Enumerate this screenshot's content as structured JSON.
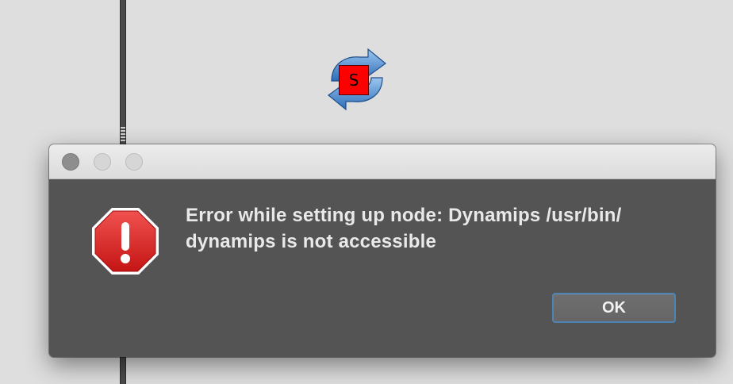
{
  "background": {
    "node": {
      "badge_letter": "S",
      "icon": "refresh-arrows-icon",
      "badge_color": "#ff0000"
    }
  },
  "dialog": {
    "title_buttons": [
      "close-icon",
      "minimize-icon",
      "zoom-icon"
    ],
    "icon": "stop-sign-warning-icon",
    "message": "Error while setting up node: Dynamips /usr/bin/ dynamips is not accessible",
    "ok_label": "OK",
    "colors": {
      "dialog_background": "#545454",
      "button_focus_ring": "#4d83b5",
      "warning_icon": "#d9201f"
    }
  }
}
